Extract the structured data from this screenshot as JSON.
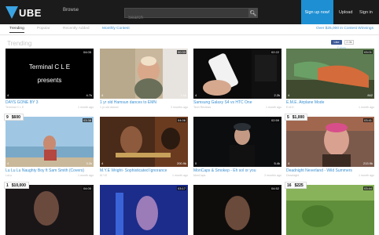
{
  "header": {
    "logo_text": "UBE",
    "browse": "Browse",
    "search_placeholder": "Search",
    "signup": "Sign up now!",
    "upload": "Upload",
    "signin": "Sign in"
  },
  "tabs": [
    "Trending",
    "Popular",
    "Recently Added",
    "Monthly Contest"
  ],
  "contest_link": "Over $25,000 in Contest Winnings",
  "section_title": "Trending",
  "social": {
    "like": "Like",
    "count": "2.0k",
    "follow": "Follow"
  },
  "cards": [
    {
      "title": "DAYS GONE BY 3",
      "author": "Terminal C L E",
      "age": "1 month ago",
      "dur": "04:05",
      "views": "4",
      "likes": "4.7k",
      "thumb_text_1": "Terminal C L E",
      "thumb_text_2": "presents"
    },
    {
      "title": "1 yr old Hamsun dances to EMN",
      "author": "1 yr old dancer",
      "age": "2 months ago",
      "dur": "00:33",
      "views": "4",
      "likes": "1.1k"
    },
    {
      "title": "Samsung Galaxy S4 vs HTC One",
      "author": "Tech Reviews",
      "age": "1 month ago",
      "dur": "02:22",
      "views": "4",
      "likes": "2.2k"
    },
    {
      "title": "E.M.E. Airplane Mode",
      "author": "E.M.E.",
      "age": "1 month ago",
      "dur": "03:01",
      "views": "4",
      "likes": "842"
    },
    {
      "title": "Lu Lu Lu Naughty Boy ft Sam Smith (Covers)",
      "author": "LuLu",
      "age": "1 month ago",
      "dur": "03:38",
      "views": "4",
      "likes": "3.2k",
      "rank": "9",
      "amount": "$600"
    },
    {
      "title": "M.Y.E Wright- Sophisticated Ignorance",
      "author": "M.Y.E",
      "age": "1 month ago",
      "dur": "04:06",
      "views": "4",
      "likes": "200.9k"
    },
    {
      "title": "MonCaps & Smokep - Eh sol or you",
      "author": "MonCaps",
      "age": "2 months ago",
      "dur": "02:59",
      "views": "0",
      "likes": "5.4k"
    },
    {
      "title": "Deadnight Neverland - Wild Summers",
      "author": "Deadnight",
      "age": "1 month ago",
      "dur": "03:41",
      "views": "4",
      "likes": "213.9k",
      "rank": "5",
      "amount": "$1,000"
    },
    {
      "title": "",
      "author": "",
      "age": "",
      "dur": "04:00",
      "views": "",
      "likes": "",
      "rank": "1",
      "amount": "$10,000"
    },
    {
      "title": "",
      "author": "",
      "age": "",
      "dur": "03:17",
      "views": "",
      "likes": ""
    },
    {
      "title": "",
      "author": "",
      "age": "",
      "dur": "04:52",
      "views": "",
      "likes": ""
    },
    {
      "title": "",
      "author": "",
      "age": "",
      "dur": "03:44",
      "views": "",
      "likes": "",
      "rank": "16",
      "amount": "$225"
    }
  ]
}
